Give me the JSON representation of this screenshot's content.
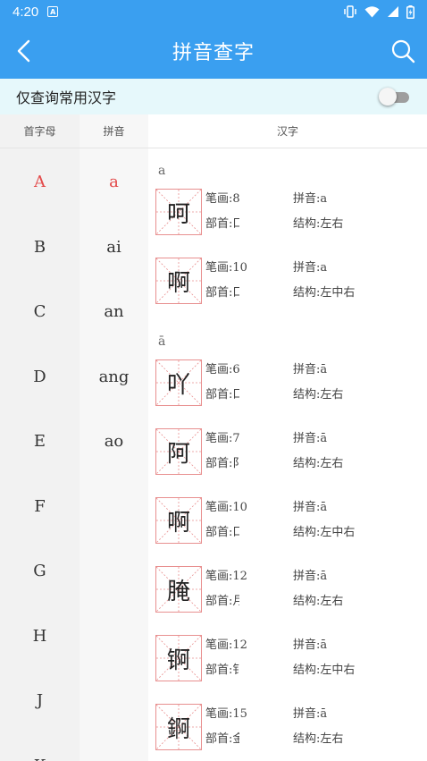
{
  "status_bar": {
    "time": "4:20",
    "notification_glyph": "A"
  },
  "app_bar": {
    "title": "拼音查字"
  },
  "filter": {
    "label": "仅查询常用汉字",
    "common_only": false
  },
  "columns": {
    "initial_header": "首字母",
    "pinyin_header": "拼音",
    "hanzi_header": "汉字"
  },
  "initials": [
    {
      "label": "A",
      "active": true
    },
    {
      "label": "B",
      "active": false
    },
    {
      "label": "C",
      "active": false
    },
    {
      "label": "D",
      "active": false
    },
    {
      "label": "E",
      "active": false
    },
    {
      "label": "F",
      "active": false
    },
    {
      "label": "G",
      "active": false
    },
    {
      "label": "H",
      "active": false
    },
    {
      "label": "J",
      "active": false
    },
    {
      "label": "K",
      "active": false
    }
  ],
  "pinyins": [
    {
      "label": "a",
      "active": true
    },
    {
      "label": "ai",
      "active": false
    },
    {
      "label": "an",
      "active": false
    },
    {
      "label": "ang",
      "active": false
    },
    {
      "label": "ao",
      "active": false
    }
  ],
  "groups": [
    {
      "label": "a",
      "chars": [
        {
          "char": "呵",
          "strokes": "笔画:8",
          "radical": "部首:口",
          "pinyin": "拼音:a",
          "structure": "结构:左右"
        },
        {
          "char": "啊",
          "strokes": "笔画:10",
          "radical": "部首:口",
          "pinyin": "拼音:a",
          "structure": "结构:左中右"
        }
      ]
    },
    {
      "label": "ā",
      "chars": [
        {
          "char": "吖",
          "strokes": "笔画:6",
          "radical": "部首:口",
          "pinyin": "拼音:ā",
          "structure": "结构:左右"
        },
        {
          "char": "阿",
          "strokes": "笔画:7",
          "radical": "部首:阝",
          "pinyin": "拼音:ā",
          "structure": "结构:左右"
        },
        {
          "char": "啊",
          "strokes": "笔画:10",
          "radical": "部首:口",
          "pinyin": "拼音:ā",
          "structure": "结构:左中右"
        },
        {
          "char": "腌",
          "strokes": "笔画:12",
          "radical": "部首:月",
          "pinyin": "拼音:ā",
          "structure": "结构:左右"
        },
        {
          "char": "锕",
          "strokes": "笔画:12",
          "radical": "部首:钅",
          "pinyin": "拼音:ā",
          "structure": "结构:左中右"
        },
        {
          "char": "錒",
          "strokes": "笔画:15",
          "radical": "部首:金",
          "pinyin": "拼音:ā",
          "structure": "结构:左右"
        }
      ]
    }
  ],
  "colors": {
    "primary": "#3a9ff0",
    "active": "#e34a4a",
    "filter_bg": "#e6f8fb",
    "grid_line": "#e89090"
  },
  "icons": {
    "back": "chevron-left-icon",
    "search": "search-icon",
    "vibrate": "vibrate-icon",
    "wifi": "wifi-icon",
    "signal": "signal-icon",
    "battery": "battery-icon"
  }
}
